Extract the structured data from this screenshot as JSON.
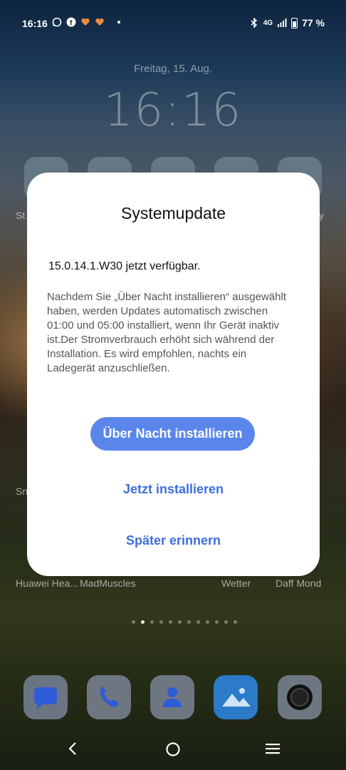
{
  "status_bar": {
    "time": "16:16",
    "network": "4G",
    "battery": "77 %",
    "battery_level": 0.77
  },
  "lockscreen": {
    "date": "Freitag, 15. Aug.",
    "clock": "16:16"
  },
  "background_labels": {
    "row1_left": "St",
    "row1_right": "y",
    "row2_left": "Sn",
    "bottom": [
      "Huawei Hea...",
      "MadMuscles",
      "Wetter",
      "Daff Mond"
    ]
  },
  "dialog": {
    "title": "Systemupdate",
    "version": "15.0.14.1.W30 jetzt verfügbar.",
    "description": "Nachdem Sie „Über Nacht installieren“ ausgewählt haben, werden Updates automatisch zwischen 01:00 und 05:00 installiert, wenn Ihr Gerät inaktiv ist.Der Stromverbrauch erhöht sich während der Installation. Es wird empfohlen, nachts ein Ladegerät anzuschließen.",
    "buttons": {
      "overnight": "Über Nacht installieren",
      "now": "Jetzt installieren",
      "later": "Später erinnern"
    }
  },
  "dock": [
    "messages-icon",
    "phone-icon",
    "contacts-icon",
    "gallery-icon",
    "camera-icon"
  ],
  "colors": {
    "accent": "#5a86ec",
    "link": "#3d6fdb"
  }
}
